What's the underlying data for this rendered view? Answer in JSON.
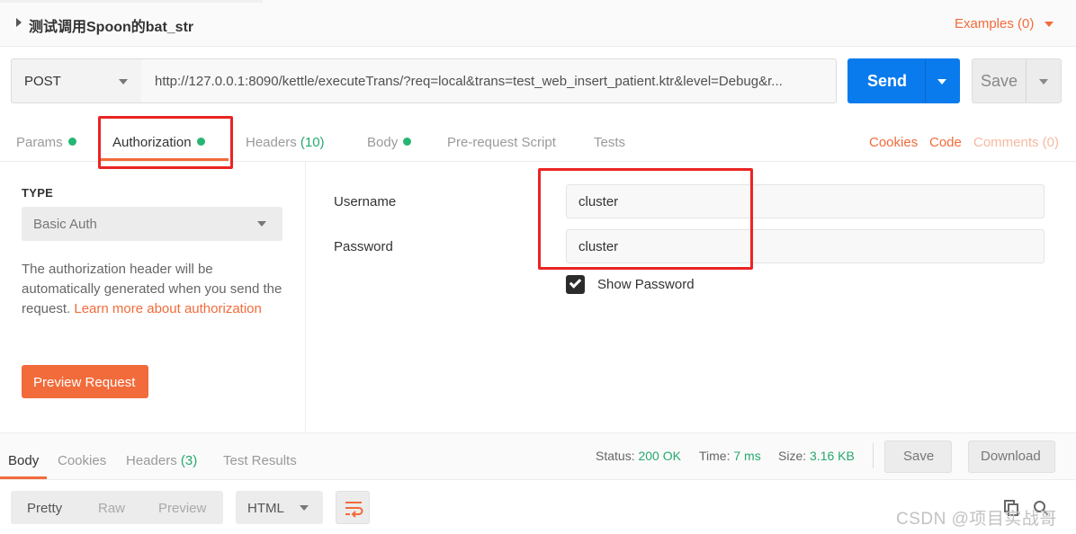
{
  "request": {
    "name": "测试调用Spoon的bat_str",
    "examples": "Examples (0)",
    "method": "POST",
    "url": "http://127.0.0.1:8090/kettle/executeTrans/?req=local&trans=test_web_insert_patient.ktr&level=Debug&r...",
    "send_label": "Send",
    "save_label": "Save"
  },
  "tabs": [
    {
      "label": "Params",
      "dot": true
    },
    {
      "label": "Authorization",
      "dot": true,
      "active": true
    },
    {
      "label": "Headers",
      "count": "(10)"
    },
    {
      "label": "Body",
      "dot": true
    },
    {
      "label": "Pre-request Script"
    },
    {
      "label": "Tests"
    }
  ],
  "tab_links": {
    "cookies": "Cookies",
    "code": "Code",
    "comments": "Comments (0)"
  },
  "auth": {
    "type_title": "TYPE",
    "type_value": "Basic Auth",
    "desc_text": "The authorization header will be automatically generated when you send the request. ",
    "desc_link": "Learn more about authorization",
    "preview_label": "Preview Request",
    "username_label": "Username",
    "username_value": "cluster",
    "password_label": "Password",
    "password_value": "cluster",
    "show_password_label": "Show Password",
    "show_password_checked": true
  },
  "response": {
    "tabs": [
      {
        "label": "Body",
        "active": true
      },
      {
        "label": "Cookies"
      },
      {
        "label": "Headers",
        "count": "(3)"
      },
      {
        "label": "Test Results"
      }
    ],
    "status_label": "Status:",
    "status_value": "200 OK",
    "time_label": "Time:",
    "time_value": "7 ms",
    "size_label": "Size:",
    "size_value": "3.16 KB",
    "save_label": "Save",
    "download_label": "Download",
    "format_tabs": [
      "Pretty",
      "Raw",
      "Preview"
    ],
    "format_select": "HTML"
  },
  "watermark": "CSDN @项目实战哥",
  "colors": {
    "accent": "#f26b3a",
    "send_blue": "#097bed",
    "status_green": "#26a86f",
    "highlight_red": "#ea2424"
  }
}
